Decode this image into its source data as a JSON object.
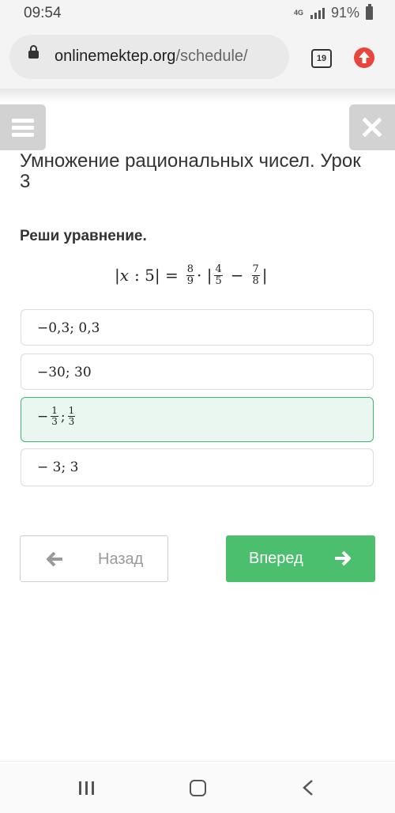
{
  "status_bar": {
    "time": "09:54",
    "network": "4G",
    "battery_percent": "91%"
  },
  "browser": {
    "domain": "onlinemektep.org",
    "path": "/schedule/",
    "tab_count": "19"
  },
  "lesson": {
    "title": "Умножение рациональных чисел. Урок 3",
    "prompt": "Реши уравнение.",
    "equation": {
      "lhs_open": "|",
      "variable": "x",
      "lhs_rest": ": 5| =",
      "f1_num": "8",
      "f1_den": "9",
      "mid": "· |",
      "f2_num": "4",
      "f2_den": "5",
      "minus": "−",
      "f3_num": "7",
      "f3_den": "8",
      "close": "|"
    },
    "options": [
      {
        "text": "−0,3; 0,3"
      },
      {
        "text": "−30; 30"
      },
      {
        "sign": "−",
        "a_num": "1",
        "a_den": "3",
        "sep": ";",
        "b_num": "1",
        "b_den": "3",
        "selected": true
      },
      {
        "text": "− 3; 3"
      }
    ]
  },
  "navigation": {
    "back_label": "Назад",
    "next_label": "Вперед"
  },
  "colors": {
    "accent_green": "#4cbf6f",
    "selected_bg": "#eaf7f1",
    "update_red": "#e8453c"
  },
  "icons": [
    "lock-icon",
    "update-icon",
    "menu-icon",
    "close-icon",
    "arrow-left-icon",
    "arrow-right-icon"
  ]
}
